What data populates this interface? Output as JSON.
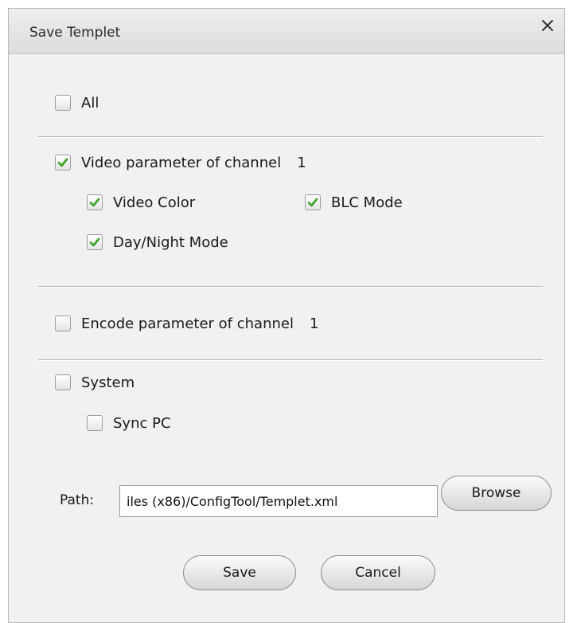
{
  "dialog": {
    "title": "Save Templet"
  },
  "options": {
    "all": {
      "label": "All",
      "checked": false
    },
    "video": {
      "label": "Video parameter of channel",
      "channel": "1",
      "checked": true,
      "video_color": {
        "label": "Video Color",
        "checked": true
      },
      "blc_mode": {
        "label": "BLC Mode",
        "checked": true
      },
      "day_night_mode": {
        "label": "Day/Night Mode",
        "checked": true
      }
    },
    "encode": {
      "label": "Encode parameter of channel",
      "channel": "1",
      "checked": false
    },
    "system": {
      "label": "System",
      "checked": false,
      "sync_pc": {
        "label": "Sync PC",
        "checked": false
      }
    }
  },
  "path": {
    "label": "Path:",
    "value": "iles (x86)/ConfigTool/Templet.xml",
    "browse_label": "Browse"
  },
  "buttons": {
    "save_label": "Save",
    "cancel_label": "Cancel"
  },
  "icons": {
    "close": "close-icon",
    "checkmark": "checkmark-icon"
  },
  "colors": {
    "checkmark": "#3aa020",
    "dialog_background": "#f1f1f1"
  }
}
